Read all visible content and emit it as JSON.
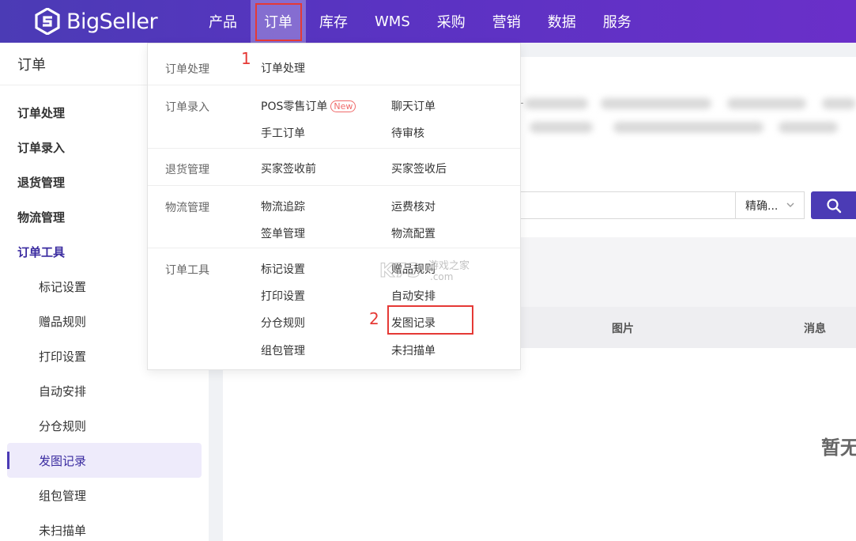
{
  "brand": {
    "name": "BigSeller"
  },
  "nav": {
    "items": [
      {
        "label": "产品"
      },
      {
        "label": "订单",
        "active": true
      },
      {
        "label": "库存"
      },
      {
        "label": "WMS"
      },
      {
        "label": "采购"
      },
      {
        "label": "营销"
      },
      {
        "label": "数据"
      },
      {
        "label": "服务"
      }
    ]
  },
  "annotations": {
    "step1": "1",
    "step2": "2",
    "color": "#e53935"
  },
  "sidebar": {
    "title": "订单",
    "groups": [
      {
        "label": "订单处理"
      },
      {
        "label": "订单录入"
      },
      {
        "label": "退货管理"
      },
      {
        "label": "物流管理"
      },
      {
        "label": "订单工具",
        "active": true
      }
    ],
    "items": [
      {
        "label": "标记设置"
      },
      {
        "label": "赠品规则"
      },
      {
        "label": "打印设置"
      },
      {
        "label": "自动安排"
      },
      {
        "label": "分仓规则"
      },
      {
        "label": "发图记录",
        "active": true
      },
      {
        "label": "组包管理"
      },
      {
        "label": "未扫描单"
      }
    ]
  },
  "dropdown": {
    "sections": [
      {
        "label": "订单处理",
        "items": [
          "订单处理"
        ]
      },
      {
        "label": "订单录入",
        "items": [
          "POS零售订单",
          "聊天订单",
          "手工订单",
          "待审核"
        ],
        "badge": "New"
      },
      {
        "label": "退货管理",
        "items": [
          "买家签收前",
          "买家签收后"
        ]
      },
      {
        "label": "物流管理",
        "items": [
          "物流追踪",
          "运费核对",
          "签单管理",
          "物流配置"
        ]
      },
      {
        "label": "订单工具",
        "items": [
          "标记设置",
          "赠品规则",
          "打印设置",
          "自动安排",
          "分仓规则",
          "发图记录",
          "组包管理",
          "未扫描单"
        ]
      }
    ]
  },
  "search": {
    "mode": "精确..."
  },
  "table": {
    "columns": [
      "图片",
      "消息"
    ],
    "empty_text": "暂无"
  },
  "watermark": {
    "text": "K73",
    "sub": "游戏之家",
    "domain": ".com"
  },
  "colors": {
    "primary": "#4b3bb5",
    "accent_red": "#e53935"
  }
}
